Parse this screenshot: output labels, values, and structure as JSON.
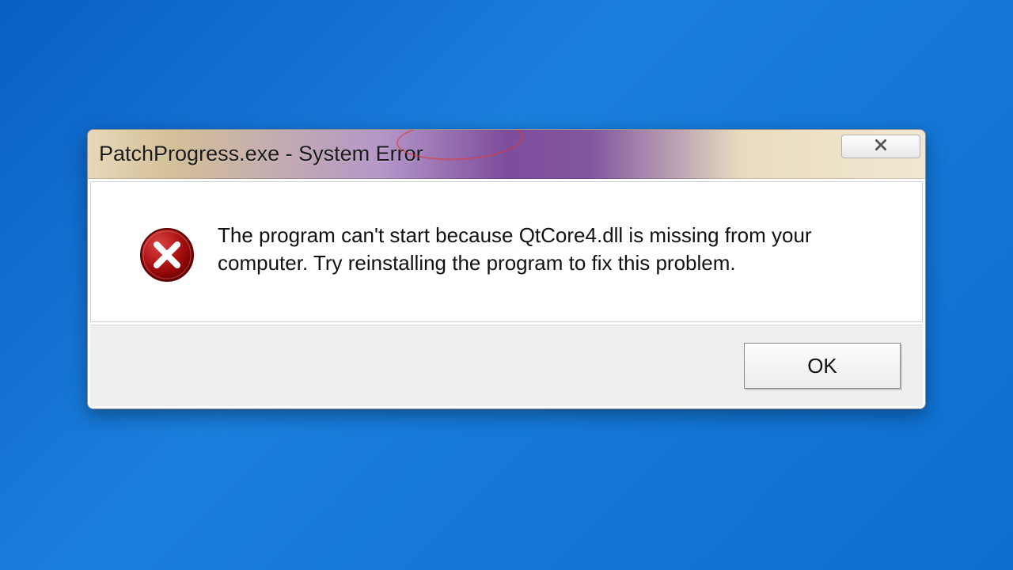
{
  "dialog": {
    "title": "PatchProgress.exe - System Error",
    "message": "The program can't start because QtCore4.dll is missing from your computer. Try reinstalling the program to fix this problem.",
    "ok_label": "OK",
    "highlighted_term": "QtCore4.dll"
  }
}
